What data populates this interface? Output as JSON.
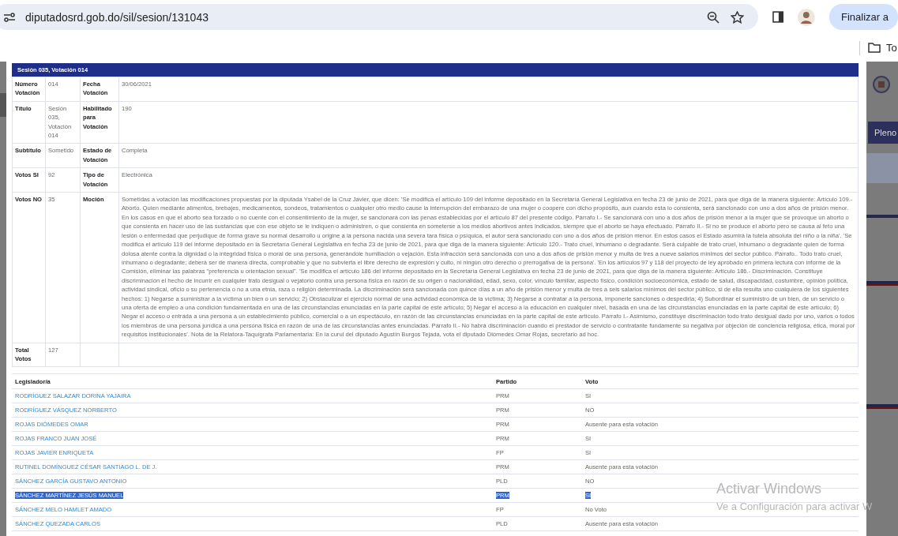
{
  "browser": {
    "url": "diputadosrd.gob.do/sil/sesion/131043",
    "action_button": "Finalizar a",
    "bookmark": "To"
  },
  "background": {
    "button": "Pleno"
  },
  "modal": {
    "title": "Sesión 035, Votación 014",
    "details": [
      {
        "label_1": "Número Votación",
        "value_1": "014",
        "label_2": "Fecha Votación",
        "value_2": "30/06/2021"
      },
      {
        "label_1": "Título",
        "value_1": "Sesión 035, Votación 014",
        "label_2": "Habilitado para Votación",
        "value_2": "190"
      },
      {
        "label_1": "Subtítulo",
        "value_1": "Sometido",
        "label_2": "Estado de Votación",
        "value_2": "Completa"
      },
      {
        "label_1": "Votos SI",
        "value_1": "92",
        "label_2": "Tipo de Votación",
        "value_2": "Electrónica"
      },
      {
        "label_1": "Votos NO",
        "value_1": "35",
        "label_2": "Moción",
        "value_2": "Sometidas a votación las modificaciones propuestas por la diputada Ysabel de la Cruz Javier, que dicen: 'Se modifica el artículo 109 del informe depositado en la Secretaría General Legislativa en fecha 23 de junio de 2021, para que diga de la manera siguiente: Artículo 109.-Aborto. Quien mediante alimentos, brebajes, medicamentos, sondeos, tratamientos o cualquier otro medio cause la interrupción del embarazo de una mujer o coopere con dicho propósito, aun cuando esta lo consienta, será sancionado con uno a dos años de prisión menor. En los casos en que el aborto sea forzado o no cuente con el consentimiento de la mujer, se sancionará con las penas establecidas por el artículo 87 del presente código. Párrafo I.- Se sancionará con uno a dos años de prisión menor a la mujer que se provoque un aborto o que consienta en hacer uso de las sustancias que con ese objeto se le indiquen o administren, o que consienta en someterse a los medios abortivos antes indicados, siempre que el aborto se haya efectuado. Párrafo II.- Si no se produce el aborto pero se causa al feto una lesión o enfermedad que perjudique de forma grave su normal desarrollo u origine a la persona nacida una severa tara física o psíquica, el autor será sancionado con uno a dos años de prisión menor. En estos casos el Estado asumirá la tutela absoluta del niño o la niña'. 'Se modifica el artículo 119 del informe depositado en la Secretaría General Legislativa en fecha 23 de junio de 2021, para que diga de la manera siguiente: Artículo 120.- Trato cruel, inhumano o degradante. Será culpable de trato cruel, inhumano o degradante quien de forma dolosa atente contra la dignidad o la integridad física o moral de una persona, generándole humillación o vejación. Esta infracción será sancionada con uno a dos años de prisión menor y multa de tres a nueve salarios mínimos del sector público. Párrafo.. Todo trato cruel, inhumano o degradante; deberá ser de manera directa, comprobable y que no subvierta el libre derecho de expresión y culto, ni ningún otro derecho o prerrogativa de la persona'. 'En los artículos 97 y 118 del proyecto de ley aprobado en primera lectura con informe de la Comisión, eliminar las palabras \"preferencia u orientación sexual\". 'Se modifica el artículo 186 del informe depositado en la Secretaría General Legislativa en fecha 23 de junio de 2021, para que diga de la manera siguiente: Artículo 186.- Discriminación. Constituye discriminación el hecho de incurrir en cualquier trato desigual o vejatorio contra una persona física en razón de su origen o nacionalidad, edad, sexo, color, vínculo familiar, aspecto físico, condición socioeconómica, estado de salud, discapacidad, costumbre, opinión política, actividad sindical, oficio o su pertenencia o no a una etnia, raza o religión determinada. La discriminación será sancionada con quince días a un año de prisión menor y multa de tres a seis salarios mínimos del sector público, si de ella resulta uno cualquiera de los siguientes hechos: 1) Negarse a suministrar a la víctima un bien o un servicio; 2) Obstaculizar el ejercicio normal de una actividad económica de la víctima; 3) Negarse a contratar a la persona, imponerle sanciones o despedirla; 4) Subordinar el suministro de un bien, de un servicio o una oferta de empleo a una condición fundamentada en una de las circunstancias enunciadas en la parte capital de este artículo; 5) Negar el acceso a la educación en cualquier nivel, basada en una de las circunstancias enunciadas en la parte capital de este artículo; 6) Negar el acceso o entrada a una persona a un establecimiento público, comercial o a un espectáculo, en razón de las circunstancias enunciadas en la parte capital de este artículo. Párrafo I.- Asimismo, constituye discriminación todo trato desigual dado por uno, varios o todos los miembros de una persona jurídica a una persona física en razón de una de las circunstancias antes enunciadas. Párrafo II.- No habrá discriminación cuando el prestador de servicio o contratante fundamente su negativa por objeción de conciencia religiosa, ética, moral por requisitos institucionales'. Nota de la Relatora-Taquígrafa Parlamentaria: En la curul del diputado Agustín Burgos Tejada, vota el diputado Diómedes Omar Rojas, secretario ad hoc."
      },
      {
        "label_1": "Total Votos",
        "value_1": "127"
      }
    ],
    "votes": {
      "columns": [
        "Legislador/a",
        "Partido",
        "Voto"
      ],
      "rows": [
        {
          "legislator": "RODRÍGUEZ SALAZAR DORINA YAJAIRA",
          "party": "PRM",
          "vote": "SI",
          "selected": false
        },
        {
          "legislator": "RODRÍGUEZ VÁSQUEZ NORBERTO",
          "party": "PRM",
          "vote": "NO",
          "selected": false
        },
        {
          "legislator": "ROJAS DIÓMEDES OMAR",
          "party": "PRM",
          "vote": "Ausente para esta votación",
          "selected": false
        },
        {
          "legislator": "ROJAS FRANCO JUAN JOSÉ",
          "party": "PRM",
          "vote": "SI",
          "selected": false
        },
        {
          "legislator": "ROJAS JAVIER ENRIQUETA",
          "party": "FP",
          "vote": "SI",
          "selected": false
        },
        {
          "legislator": "RUTINEL DOMÍNGUEZ CÉSAR SANTIAGO L. DE J.",
          "party": "PRM",
          "vote": "Ausente para esta votación",
          "selected": false
        },
        {
          "legislator": "SÁNCHEZ GARCÍA GUSTAVO ANTONIO",
          "party": "PLD",
          "vote": "NO",
          "selected": false
        },
        {
          "legislator": "SÁNCHEZ MARTÍNEZ JESÚS MANUEL",
          "party": "PRM",
          "vote": "SI",
          "selected": true
        },
        {
          "legislator": "SÁNCHEZ MELO HAMLET AMADO",
          "party": "FP",
          "vote": "No Voto",
          "selected": false
        },
        {
          "legislator": "SÁNCHEZ QUEZADA CARLOS",
          "party": "PLD",
          "vote": "Ausente para esta votación",
          "selected": false
        }
      ]
    }
  },
  "windows_activation": {
    "title": "Activar Windows",
    "subtitle": "Ve a Configuración para activar W"
  }
}
